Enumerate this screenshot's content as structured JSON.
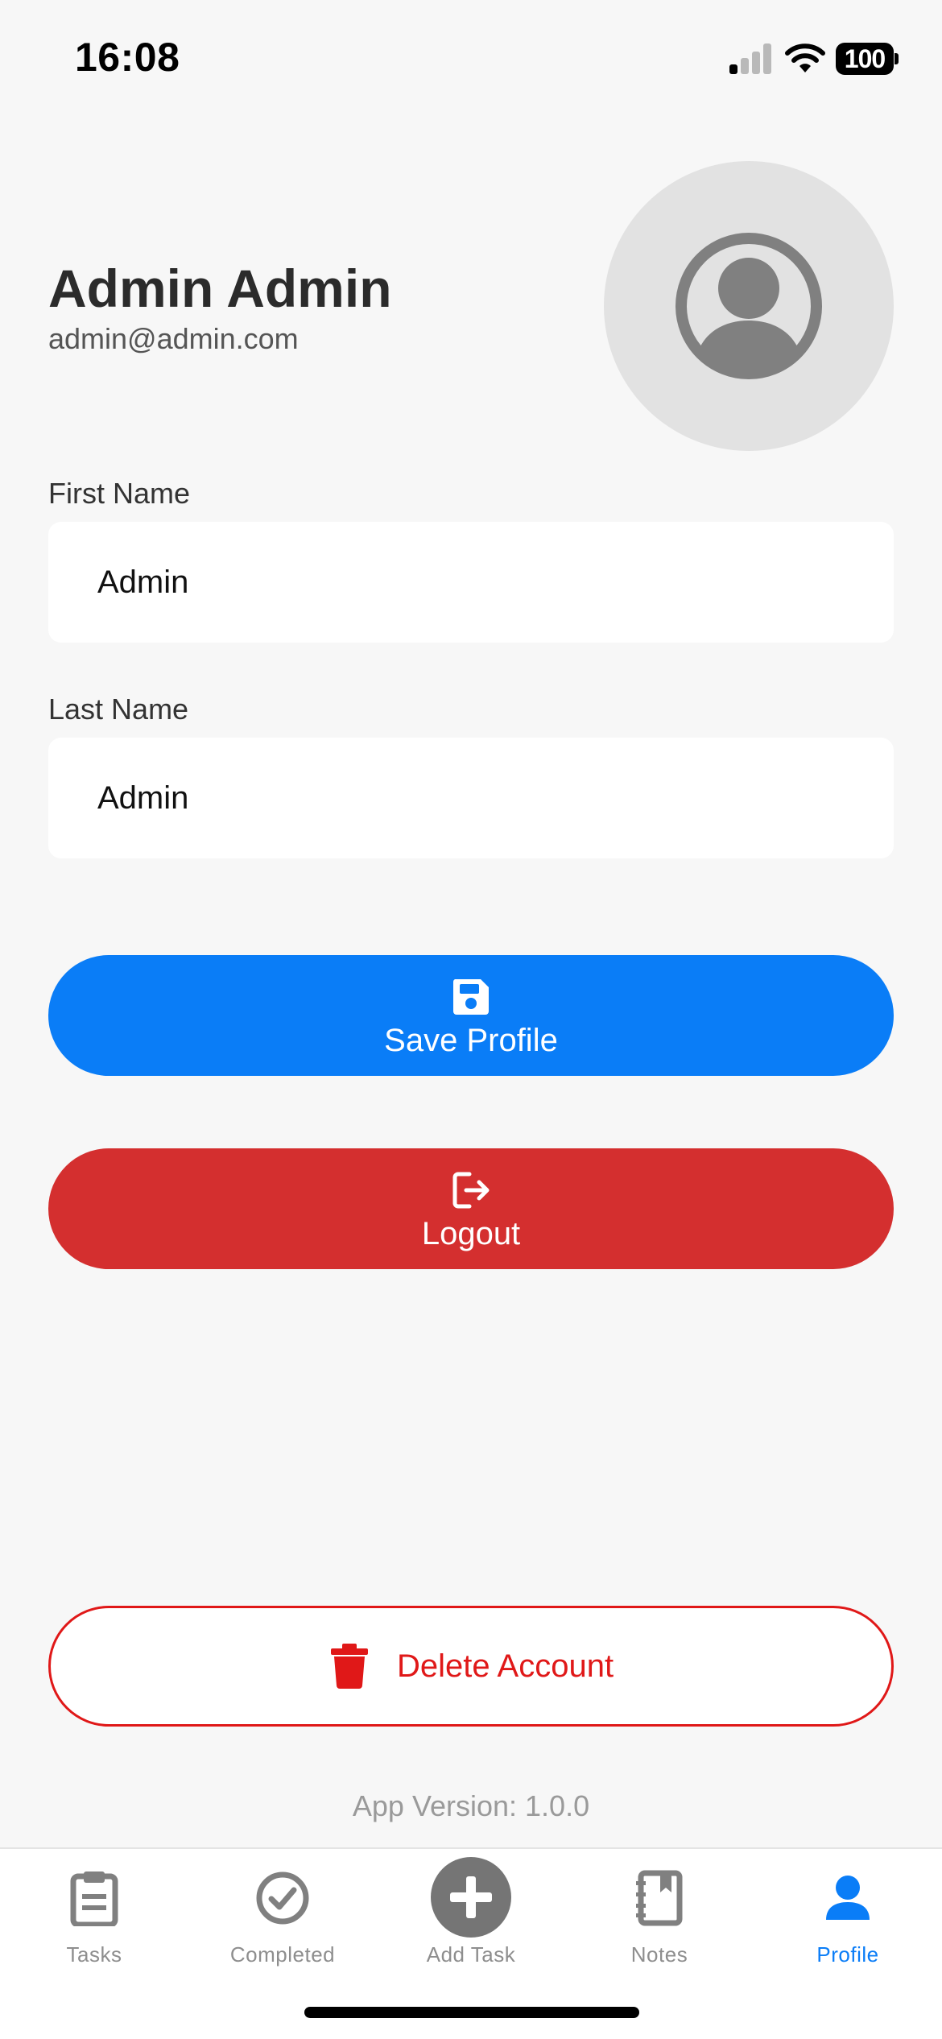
{
  "status_bar": {
    "time": "16:08",
    "battery": "100"
  },
  "profile": {
    "name": "Admin Admin",
    "email": "admin@admin.com",
    "avatar_icon": "user-circle-icon"
  },
  "form": {
    "first_name_label": "First Name",
    "first_name_value": "Admin",
    "last_name_label": "Last Name",
    "last_name_value": "Admin"
  },
  "actions": {
    "save_label": "Save Profile",
    "save_icon": "floppy-disk-icon",
    "save_color": "#0a7df7",
    "logout_label": "Logout",
    "logout_icon": "sign-out-icon",
    "logout_color": "#d42f2f",
    "delete_label": "Delete Account",
    "delete_icon": "trash-icon",
    "delete_color": "#e01818"
  },
  "footer": {
    "version_text": "App Version: 1.0.0"
  },
  "tab_bar": {
    "active_color": "#0a7df7",
    "tabs": [
      {
        "label": "Tasks",
        "icon": "clipboard-icon"
      },
      {
        "label": "Completed",
        "icon": "check-circle-icon"
      },
      {
        "label": "Add Task",
        "icon": "plus-circle-icon"
      },
      {
        "label": "Notes",
        "icon": "notebook-icon"
      },
      {
        "label": "Profile",
        "icon": "person-icon",
        "active": true
      }
    ]
  }
}
